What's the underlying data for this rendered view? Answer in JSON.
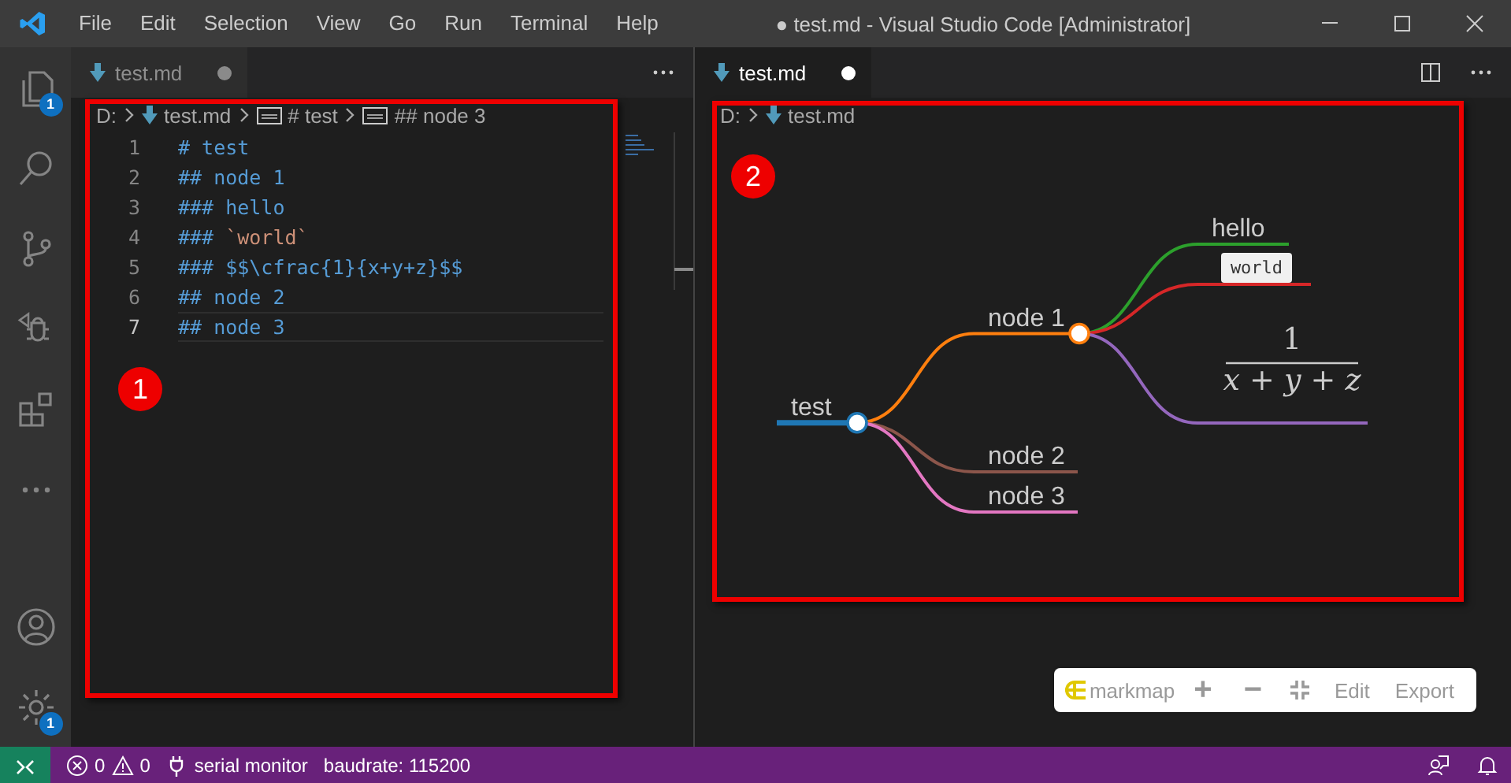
{
  "window": {
    "title": "● test.md - Visual Studio Code [Administrator]"
  },
  "menu": [
    "File",
    "Edit",
    "Selection",
    "View",
    "Go",
    "Run",
    "Terminal",
    "Help"
  ],
  "activity_bar": [
    {
      "kind": "files",
      "badge": "1"
    },
    {
      "kind": "search"
    },
    {
      "kind": "source-control"
    },
    {
      "kind": "debug"
    },
    {
      "kind": "extensions"
    },
    {
      "kind": "more"
    }
  ],
  "activity_bar_bottom": [
    {
      "kind": "account"
    },
    {
      "kind": "settings",
      "badge": "1"
    }
  ],
  "editor": {
    "annotation": "1",
    "tab": {
      "label": "test.md",
      "selected": false,
      "dirty": true
    },
    "breadcrumbs": [
      {
        "kind": "text",
        "text": "D:"
      },
      {
        "kind": "file",
        "text": "test.md"
      },
      {
        "kind": "symbol",
        "text": "# test"
      },
      {
        "kind": "symbol",
        "text": "## node 3"
      }
    ],
    "lines": [
      {
        "number": "1",
        "current": false,
        "segments": [
          {
            "kind": "heading",
            "text": "# test"
          }
        ]
      },
      {
        "number": "2",
        "current": false,
        "segments": [
          {
            "kind": "heading",
            "text": "## node 1"
          }
        ]
      },
      {
        "number": "3",
        "current": false,
        "segments": [
          {
            "kind": "heading",
            "text": "### hello"
          }
        ]
      },
      {
        "number": "4",
        "current": false,
        "segments": [
          {
            "kind": "heading",
            "text": "### "
          },
          {
            "kind": "code",
            "text": "`world`"
          }
        ]
      },
      {
        "number": "5",
        "current": false,
        "segments": [
          {
            "kind": "heading",
            "text": "### $$\\cfrac{1}{x+y+z}$$"
          }
        ]
      },
      {
        "number": "6",
        "current": false,
        "segments": [
          {
            "kind": "heading",
            "text": "## node 2"
          }
        ]
      },
      {
        "number": "7",
        "current": true,
        "segments": [
          {
            "kind": "heading",
            "text": "## node 3"
          }
        ]
      }
    ]
  },
  "preview": {
    "annotation": "2",
    "tab": {
      "label": "test.md",
      "selected": true,
      "dirty": true
    },
    "breadcrumbs": [
      {
        "kind": "text",
        "text": "D:"
      },
      {
        "kind": "file",
        "text": "test.md"
      }
    ],
    "mindmap": {
      "root": {
        "kind": "text",
        "label": "test",
        "color": "#1f77b4",
        "children": [
          {
            "kind": "text",
            "label": "node 1",
            "color": "#ff7f0e",
            "children": [
              {
                "kind": "text",
                "label": "hello",
                "color": "#2ca02c"
              },
              {
                "kind": "code",
                "label": "world",
                "color": "#d62728"
              },
              {
                "kind": "fraction",
                "numerator": "1",
                "denominator": "x + y + z",
                "color": "#9467bd"
              }
            ]
          },
          {
            "kind": "text",
            "label": "node 2",
            "color": "#8c564b"
          },
          {
            "kind": "text",
            "label": "node 3",
            "color": "#e377c2"
          }
        ]
      }
    },
    "toolbar": {
      "brand": "markmap",
      "buttons": [
        {
          "kind": "zoom-in",
          "text": "+"
        },
        {
          "kind": "zoom-out",
          "text": "−"
        },
        {
          "kind": "fit"
        },
        {
          "kind": "edit",
          "text": "Edit"
        },
        {
          "kind": "export",
          "text": "Export"
        }
      ]
    }
  },
  "status_bar": {
    "errors": "0",
    "warnings": "0",
    "items": [
      {
        "kind": "plug",
        "text": "serial monitor"
      },
      {
        "kind": "text",
        "text": "baudrate: 115200"
      }
    ]
  }
}
